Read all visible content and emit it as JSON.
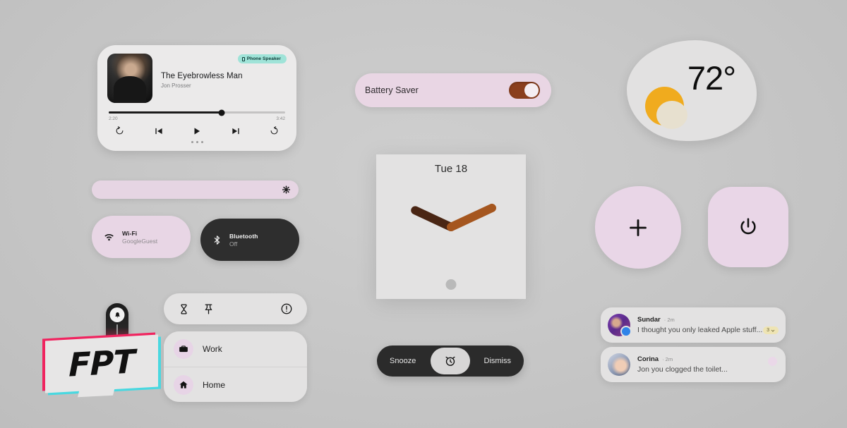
{
  "background": {
    "color": "#c6c6c6"
  },
  "media_player": {
    "name": "media-player",
    "track_title": "The Eyebrowless Man",
    "artist": "Jon Prosser",
    "output_chip": "Phone Speaker",
    "output_chip_color": "#9fe3d8",
    "elapsed": "2:20",
    "duration": "3:42",
    "progress_percent": 64,
    "controls": [
      {
        "name": "replay-10-button",
        "glyph": "replay"
      },
      {
        "name": "previous-track-button",
        "glyph": "prev"
      },
      {
        "name": "play-button",
        "glyph": "play"
      },
      {
        "name": "next-track-button",
        "glyph": "next"
      },
      {
        "name": "forward-10-button",
        "glyph": "forward"
      }
    ]
  },
  "battery_saver": {
    "label": "Battery Saver",
    "enabled": true,
    "tile_color": "#e9d6e4",
    "toggle_on_color": "#8a3f1d"
  },
  "weather": {
    "temperature": "72°",
    "condition_icon": "sun-behind-cloud-icon",
    "sun_color": "#f0ab1e",
    "cloud_color": "#e7e0cf"
  },
  "brightness": {
    "name": "brightness-slider",
    "icon": "brightness-icon",
    "track_color": "#e6d5e3"
  },
  "quick_tiles": [
    {
      "name": "wifi-tile",
      "icon": "wifi-icon",
      "title": "Wi-Fi",
      "subtitle": "GoogleGuest",
      "state": "on",
      "color": "#e8d6e5"
    },
    {
      "name": "bluetooth-tile",
      "icon": "bluetooth-icon",
      "title": "Bluetooth",
      "subtitle": "Off",
      "state": "off",
      "color": "#2e2e2e"
    }
  ],
  "clock": {
    "date": "Tue 18",
    "hour_hand_color": "#4a2614",
    "minute_hand_color": "#a5561f",
    "face_color": "#e3e2e2"
  },
  "action_buttons": [
    {
      "name": "add-button",
      "icon": "plus-icon",
      "color": "#e9d6e7"
    },
    {
      "name": "power-button",
      "icon": "power-icon",
      "color": "#e9d6e7"
    }
  ],
  "quick_bar": {
    "icons": [
      {
        "name": "hourglass-icon",
        "label": "hourglass"
      },
      {
        "name": "pin-icon",
        "label": "pin"
      },
      {
        "name": "alert-circle-icon",
        "label": "alert"
      }
    ]
  },
  "shortcuts": [
    {
      "name": "shortcut-work",
      "icon": "briefcase-icon",
      "label": "Work"
    },
    {
      "name": "shortcut-home",
      "icon": "home-icon",
      "label": "Home"
    }
  ],
  "alarm_bar": {
    "snooze_label": "Snooze",
    "dismiss_label": "Dismiss",
    "center_icon": "alarm-clock-icon",
    "bar_color": "#2b2b2b"
  },
  "notifications": [
    {
      "name": "notification-sundar",
      "sender": "Sundar",
      "time": "· 2m",
      "message": "I thought you only leaked Apple stuff...",
      "badge": "3",
      "has_badge": true,
      "badge_color": "#eee4b4"
    },
    {
      "name": "notification-corina",
      "sender": "Corina",
      "time": "· 2m",
      "message": "Jon you clogged the toilet...",
      "has_badge": false
    }
  ],
  "watermark": {
    "text": "FPT",
    "bell_icon": "bell-icon"
  }
}
